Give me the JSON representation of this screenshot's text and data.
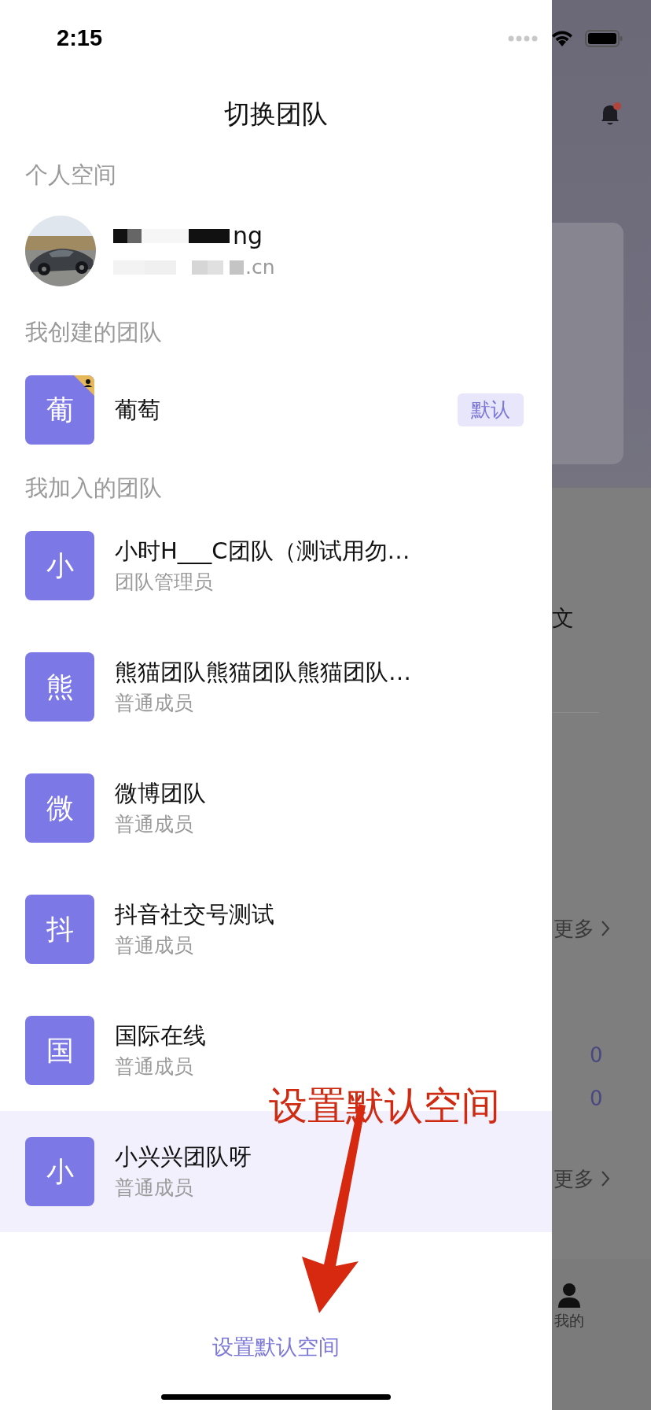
{
  "status_bar": {
    "time": "2:15"
  },
  "drawer": {
    "title": "切换团队",
    "personal": {
      "heading": "个人空间",
      "name": "ng",
      "email": ".cn"
    },
    "created": {
      "heading": "我创建的团队",
      "teams": [
        {
          "initial": "葡",
          "name": "葡萄",
          "owner": true,
          "tag": "默认",
          "selected": false
        }
      ]
    },
    "joined": {
      "heading": "我加入的团队",
      "teams": [
        {
          "initial": "小",
          "name": "小时H___C团队（测试用勿…",
          "role": "团队管理员",
          "selected": false
        },
        {
          "initial": "熊",
          "name": "熊猫团队熊猫团队熊猫团队…",
          "role": "普通成员",
          "selected": false
        },
        {
          "initial": "微",
          "name": "微博团队",
          "role": "普通成员",
          "selected": false
        },
        {
          "initial": "抖",
          "name": "抖音社交号测试",
          "role": "普通成员",
          "selected": false
        },
        {
          "initial": "国",
          "name": "国际在线",
          "role": "普通成员",
          "selected": false
        },
        {
          "initial": "小",
          "name": "小兴兴团队呀",
          "role": "普通成员",
          "selected": true
        }
      ]
    },
    "footer_button": "设置默认空间"
  },
  "annotation": {
    "text": "设置默认空间"
  },
  "background_page": {
    "bell_unread": true,
    "items": [
      {
        "kind": "text",
        "text": "文"
      },
      {
        "kind": "more",
        "text": "更多"
      },
      {
        "kind": "count",
        "text": "0"
      },
      {
        "kind": "count",
        "text": "0"
      },
      {
        "kind": "more",
        "text": "更多"
      }
    ],
    "tab": {
      "label": "我的"
    }
  }
}
